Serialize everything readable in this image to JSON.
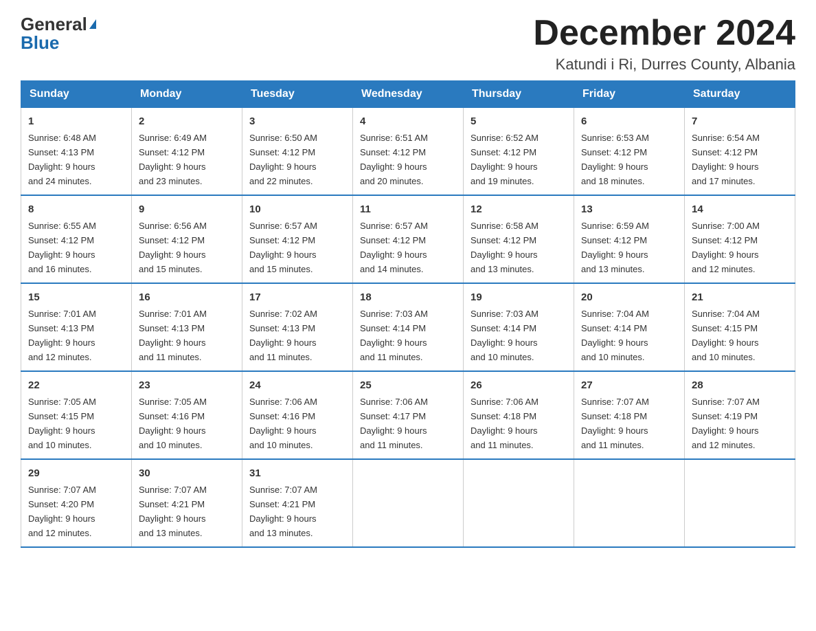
{
  "header": {
    "logo_general": "General",
    "logo_blue": "Blue",
    "title": "December 2024",
    "subtitle": "Katundi i Ri, Durres County, Albania"
  },
  "days_of_week": [
    "Sunday",
    "Monday",
    "Tuesday",
    "Wednesday",
    "Thursday",
    "Friday",
    "Saturday"
  ],
  "weeks": [
    [
      {
        "day": "1",
        "sunrise": "6:48 AM",
        "sunset": "4:13 PM",
        "daylight": "9 hours and 24 minutes."
      },
      {
        "day": "2",
        "sunrise": "6:49 AM",
        "sunset": "4:12 PM",
        "daylight": "9 hours and 23 minutes."
      },
      {
        "day": "3",
        "sunrise": "6:50 AM",
        "sunset": "4:12 PM",
        "daylight": "9 hours and 22 minutes."
      },
      {
        "day": "4",
        "sunrise": "6:51 AM",
        "sunset": "4:12 PM",
        "daylight": "9 hours and 20 minutes."
      },
      {
        "day": "5",
        "sunrise": "6:52 AM",
        "sunset": "4:12 PM",
        "daylight": "9 hours and 19 minutes."
      },
      {
        "day": "6",
        "sunrise": "6:53 AM",
        "sunset": "4:12 PM",
        "daylight": "9 hours and 18 minutes."
      },
      {
        "day": "7",
        "sunrise": "6:54 AM",
        "sunset": "4:12 PM",
        "daylight": "9 hours and 17 minutes."
      }
    ],
    [
      {
        "day": "8",
        "sunrise": "6:55 AM",
        "sunset": "4:12 PM",
        "daylight": "9 hours and 16 minutes."
      },
      {
        "day": "9",
        "sunrise": "6:56 AM",
        "sunset": "4:12 PM",
        "daylight": "9 hours and 15 minutes."
      },
      {
        "day": "10",
        "sunrise": "6:57 AM",
        "sunset": "4:12 PM",
        "daylight": "9 hours and 15 minutes."
      },
      {
        "day": "11",
        "sunrise": "6:57 AM",
        "sunset": "4:12 PM",
        "daylight": "9 hours and 14 minutes."
      },
      {
        "day": "12",
        "sunrise": "6:58 AM",
        "sunset": "4:12 PM",
        "daylight": "9 hours and 13 minutes."
      },
      {
        "day": "13",
        "sunrise": "6:59 AM",
        "sunset": "4:12 PM",
        "daylight": "9 hours and 13 minutes."
      },
      {
        "day": "14",
        "sunrise": "7:00 AM",
        "sunset": "4:12 PM",
        "daylight": "9 hours and 12 minutes."
      }
    ],
    [
      {
        "day": "15",
        "sunrise": "7:01 AM",
        "sunset": "4:13 PM",
        "daylight": "9 hours and 12 minutes."
      },
      {
        "day": "16",
        "sunrise": "7:01 AM",
        "sunset": "4:13 PM",
        "daylight": "9 hours and 11 minutes."
      },
      {
        "day": "17",
        "sunrise": "7:02 AM",
        "sunset": "4:13 PM",
        "daylight": "9 hours and 11 minutes."
      },
      {
        "day": "18",
        "sunrise": "7:03 AM",
        "sunset": "4:14 PM",
        "daylight": "9 hours and 11 minutes."
      },
      {
        "day": "19",
        "sunrise": "7:03 AM",
        "sunset": "4:14 PM",
        "daylight": "9 hours and 10 minutes."
      },
      {
        "day": "20",
        "sunrise": "7:04 AM",
        "sunset": "4:14 PM",
        "daylight": "9 hours and 10 minutes."
      },
      {
        "day": "21",
        "sunrise": "7:04 AM",
        "sunset": "4:15 PM",
        "daylight": "9 hours and 10 minutes."
      }
    ],
    [
      {
        "day": "22",
        "sunrise": "7:05 AM",
        "sunset": "4:15 PM",
        "daylight": "9 hours and 10 minutes."
      },
      {
        "day": "23",
        "sunrise": "7:05 AM",
        "sunset": "4:16 PM",
        "daylight": "9 hours and 10 minutes."
      },
      {
        "day": "24",
        "sunrise": "7:06 AM",
        "sunset": "4:16 PM",
        "daylight": "9 hours and 10 minutes."
      },
      {
        "day": "25",
        "sunrise": "7:06 AM",
        "sunset": "4:17 PM",
        "daylight": "9 hours and 11 minutes."
      },
      {
        "day": "26",
        "sunrise": "7:06 AM",
        "sunset": "4:18 PM",
        "daylight": "9 hours and 11 minutes."
      },
      {
        "day": "27",
        "sunrise": "7:07 AM",
        "sunset": "4:18 PM",
        "daylight": "9 hours and 11 minutes."
      },
      {
        "day": "28",
        "sunrise": "7:07 AM",
        "sunset": "4:19 PM",
        "daylight": "9 hours and 12 minutes."
      }
    ],
    [
      {
        "day": "29",
        "sunrise": "7:07 AM",
        "sunset": "4:20 PM",
        "daylight": "9 hours and 12 minutes."
      },
      {
        "day": "30",
        "sunrise": "7:07 AM",
        "sunset": "4:21 PM",
        "daylight": "9 hours and 13 minutes."
      },
      {
        "day": "31",
        "sunrise": "7:07 AM",
        "sunset": "4:21 PM",
        "daylight": "9 hours and 13 minutes."
      },
      null,
      null,
      null,
      null
    ]
  ],
  "labels": {
    "sunrise": "Sunrise:",
    "sunset": "Sunset:",
    "daylight": "Daylight:"
  }
}
